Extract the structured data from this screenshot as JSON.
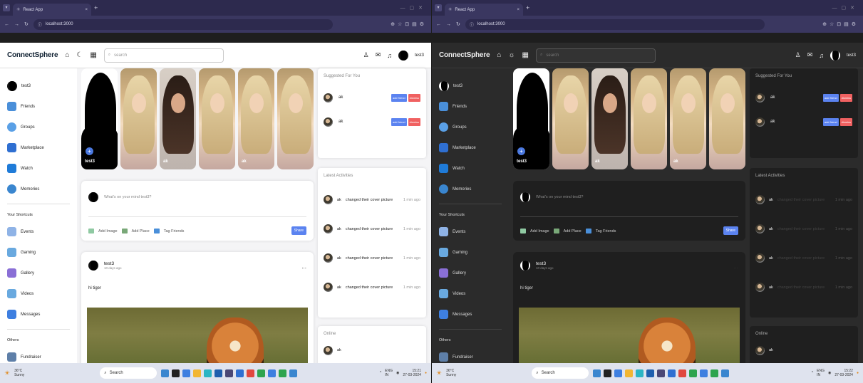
{
  "colors": {
    "accent": "#5b83f0",
    "danger": "#f06161",
    "tabbar": "#2d2a4e",
    "dark_bg": "#2b2b2b",
    "light_bg": "#f4f4f6"
  },
  "browser": {
    "tab_title": "React App",
    "tab_close": "×",
    "new_tab": "+",
    "url": "localhost:3000"
  },
  "app": {
    "logo": "ConnectSphere",
    "search_placeholder": "search",
    "username": "test3",
    "sidebar": {
      "main": [
        {
          "label": "test3",
          "icon": "avatar"
        },
        {
          "label": "Friends",
          "icon": "friends-icon",
          "color": "#4a8fd9"
        },
        {
          "label": "Groups",
          "icon": "groups-icon",
          "color": "#5aa0e6"
        },
        {
          "label": "Marketplace",
          "icon": "marketplace-icon",
          "color": "#2f6fd1"
        },
        {
          "label": "Watch",
          "icon": "watch-icon",
          "color": "#1f7bd8"
        },
        {
          "label": "Memories",
          "icon": "memories-icon",
          "color": "#3a86cf"
        }
      ],
      "shortcuts_title": "Your Shortcuts",
      "shortcuts": [
        {
          "label": "Events",
          "icon": "events-icon",
          "color": "#8fb3e6"
        },
        {
          "label": "Gaming",
          "icon": "gaming-icon",
          "color": "#69a9df"
        },
        {
          "label": "Gallery",
          "icon": "gallery-icon",
          "color": "#8a6fd6"
        },
        {
          "label": "Videos",
          "icon": "videos-icon",
          "color": "#69a9df"
        },
        {
          "label": "Messages",
          "icon": "messages-icon",
          "color": "#3e7fe0"
        }
      ],
      "others_title": "Others",
      "others": [
        {
          "label": "Fundraiser",
          "icon": "fundraiser-icon",
          "color": "#5e7fa8"
        }
      ]
    },
    "stories": [
      {
        "label": "test3",
        "kind": "me"
      },
      {
        "label": "",
        "kind": "blonde"
      },
      {
        "label": "ak",
        "kind": "dark"
      },
      {
        "label": "",
        "kind": "blonde"
      },
      {
        "label": "ak",
        "kind": "blonde"
      },
      {
        "label": "",
        "kind": "blonde"
      }
    ],
    "share": {
      "placeholder": "What's on your mind test3?",
      "add_image": "Add Image",
      "add_place": "Add Place",
      "tag_friends": "Tag Friends",
      "share_button": "Share"
    },
    "post": {
      "author": "test3",
      "time": "10 days ago",
      "text": "hi tiger",
      "more": "..."
    },
    "suggested": {
      "title": "Suggested For You",
      "people": [
        {
          "name": "ak",
          "add": "add friend",
          "dismiss": "dismiss"
        },
        {
          "name": "ak",
          "add": "add friend",
          "dismiss": "dismiss"
        }
      ]
    },
    "activities": {
      "title": "Latest Activities",
      "items": [
        {
          "name": "ak",
          "text": "changed their cover picture",
          "time": "1 min ago"
        },
        {
          "name": "ak",
          "text": "changed their cover picture",
          "time": "1 min ago"
        },
        {
          "name": "ak",
          "text": "changed their cover picture",
          "time": "1 min ago"
        },
        {
          "name": "ak",
          "text": "changed their cover picture",
          "time": "1 min ago"
        }
      ]
    },
    "online": {
      "title": "Online",
      "people": [
        {
          "name": "ak"
        }
      ]
    }
  },
  "taskbar": {
    "weather_temp": "36°C",
    "weather_text": "Sunny",
    "search": "Search",
    "lang_left": "ENG",
    "lang_right": "IN",
    "clock_left_time": "15:21",
    "clock_right_time": "15:22",
    "date": "27-03-2024"
  }
}
